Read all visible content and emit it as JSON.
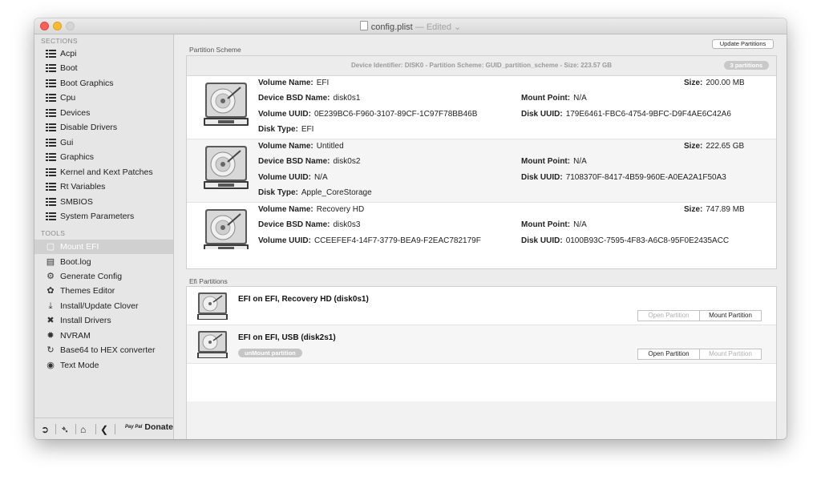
{
  "window": {
    "title": "config.plist",
    "edited": " — Edited ⌄"
  },
  "sidebar": {
    "sections_header": "SECTIONS",
    "sections": [
      {
        "label": "Acpi"
      },
      {
        "label": "Boot"
      },
      {
        "label": "Boot Graphics"
      },
      {
        "label": "Cpu"
      },
      {
        "label": "Devices"
      },
      {
        "label": "Disable Drivers"
      },
      {
        "label": "Gui"
      },
      {
        "label": "Graphics"
      },
      {
        "label": "Kernel and Kext Patches"
      },
      {
        "label": "Rt Variables"
      },
      {
        "label": "SMBIOS"
      },
      {
        "label": "System Parameters"
      }
    ],
    "tools_header": "TOOLS",
    "tools": [
      {
        "label": "Mount EFI",
        "icon": "disk-icon",
        "selected": true
      },
      {
        "label": "Boot.log",
        "icon": "log-icon"
      },
      {
        "label": "Generate Config",
        "icon": "gears-icon"
      },
      {
        "label": "Themes Editor",
        "icon": "palette-icon"
      },
      {
        "label": "Install/Update Clover",
        "icon": "download-icon"
      },
      {
        "label": "Install Drivers",
        "icon": "tools-icon"
      },
      {
        "label": "NVRAM",
        "icon": "chip-icon"
      },
      {
        "label": "Base64 to HEX converter",
        "icon": "refresh-icon"
      },
      {
        "label": "Text Mode",
        "icon": "eye-icon"
      }
    ],
    "bottom": {
      "donate_label": "Donate",
      "paypal_label": "Pay Pal"
    }
  },
  "partition_scheme": {
    "section_label": "Partition Scheme",
    "update_button": "Update Partitions",
    "device_info": "Device Identifier: DISK0 - Partition Scheme: GUID_partition_scheme - Size: 223.57 GB",
    "partition_count": "3 partitions",
    "labels": {
      "volume_name": "Volume Name:",
      "bsd_name": "Device BSD Name:",
      "volume_uuid": "Volume UUID:",
      "disk_type": "Disk Type:",
      "size": "Size:",
      "mount_point": "Mount Point:",
      "disk_uuid": "Disk UUID:"
    },
    "volumes": [
      {
        "volume_name": "EFI",
        "bsd_name": "disk0s1",
        "volume_uuid": "0E239BC6-F960-3107-89CF-1C97F78BB46B",
        "disk_type": "EFI",
        "size": "200.00 MB",
        "mount_point": "N/A",
        "disk_uuid": "179E6461-FBC6-4754-9BFC-D9F4AE6C42A6"
      },
      {
        "volume_name": "Untitled",
        "bsd_name": "disk0s2",
        "volume_uuid": "N/A",
        "disk_type": "Apple_CoreStorage",
        "size": "222.65 GB",
        "mount_point": "N/A",
        "disk_uuid": "7108370F-8417-4B59-960E-A0EA2A1F50A3"
      },
      {
        "volume_name": "Recovery HD",
        "bsd_name": "disk0s3",
        "volume_uuid": "CCEEFEF4-14F7-3779-BEA9-F2EAC782179F",
        "disk_type": "",
        "size": "747.89 MB",
        "mount_point": "N/A",
        "disk_uuid": "0100B93C-7595-4F83-A6C8-95F0E2435ACC"
      }
    ]
  },
  "efi_partitions": {
    "section_label": "Efi Partitions",
    "rows": [
      {
        "title": "EFI on EFI, Recovery HD (disk0s1)",
        "open_label": "Open Partition",
        "mount_label": "Mount Partition",
        "open_enabled": false,
        "mount_enabled": true
      },
      {
        "title": "EFI on EFI, USB (disk2s1)",
        "unmount_label": "unMount partition",
        "open_label": "Open Partition",
        "mount_label": "Mount Partition",
        "open_enabled": true,
        "mount_enabled": false
      }
    ]
  }
}
